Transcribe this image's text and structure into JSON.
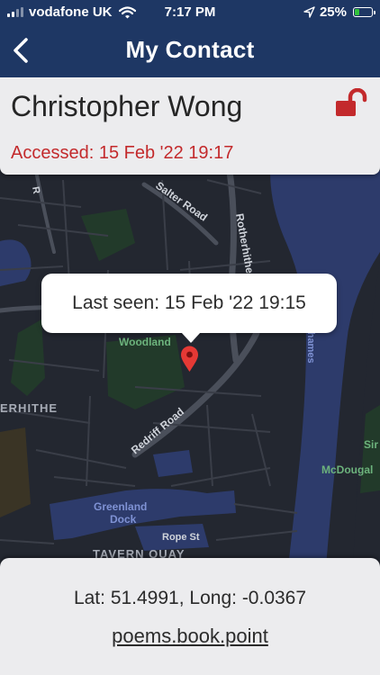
{
  "status_bar": {
    "carrier": "vodafone UK",
    "time": "7:17 PM",
    "battery_text": "25%",
    "battery_level": 0.25
  },
  "header": {
    "title": "My Contact"
  },
  "contact": {
    "name": "Christopher Wong",
    "accessed": "Accessed: 15 Feb '22  19:17"
  },
  "map": {
    "last_seen": "Last seen: 15 Feb '22  19:15",
    "labels": {
      "salter_road": "Salter Road",
      "rotherhithe": "Rotherhithe",
      "thames": "Thames",
      "woodland": "Woodland",
      "rhithe_district": "ERHITHE",
      "redriff_road": "Redriff Road",
      "sir_john": "Sir Jo",
      "mcdougal": "McDougal",
      "greenland": "Greenland",
      "dock": "Dock",
      "rope_st": "Rope St",
      "tavern_quay": "TAVERN QUAY",
      "edge_r": "R"
    }
  },
  "location": {
    "lat_label": "Lat:",
    "lat": "51.4991",
    "long_label": "Long:",
    "long": "-0.0367",
    "what3words": "poems.book.point"
  },
  "colors": {
    "header": "#1e3764",
    "accent_red": "#c32a2c",
    "card": "#ececee",
    "water": "#2d3b6b",
    "park": "#223a2a"
  }
}
